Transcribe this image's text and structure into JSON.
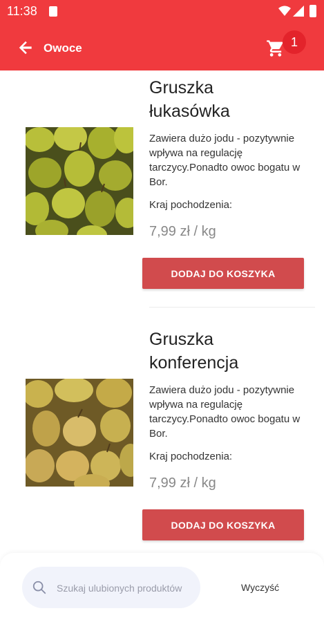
{
  "status_bar": {
    "time": "11:38"
  },
  "toolbar": {
    "title": "Owoce",
    "cart_count": "1"
  },
  "products": [
    {
      "name_line1": "Gruszka",
      "name_line2": "łukasówka",
      "description": "Zawiera dużo jodu - pozytywnie wpływa na regulację tarczycy.Ponadto owoc bogatu w Bor.",
      "origin_label": "Kraj pochodzenia:",
      "price": "7,99 zł / kg",
      "button_label": "DODAJ DO KOSZYKA"
    },
    {
      "name_line1": "Gruszka",
      "name_line2": "konferencja",
      "description": "Zawiera dużo jodu - pozytywnie wpływa na regulację tarczycy.Ponadto owoc bogatu w Bor.",
      "origin_label": "Kraj pochodzenia:",
      "price": "7,99 zł / kg",
      "button_label": "DODAJ DO KOSZYKA"
    }
  ],
  "search": {
    "placeholder": "Szukaj ulubionych produktów",
    "clear_label": "Wyczyść"
  },
  "colors": {
    "primary": "#f03a3e",
    "button": "#d14b4d",
    "badge": "#e3232b"
  },
  "icons": [
    "back-arrow-icon",
    "cart-icon",
    "search-icon",
    "wifi-icon",
    "signal-icon",
    "battery-icon",
    "sim-icon"
  ]
}
